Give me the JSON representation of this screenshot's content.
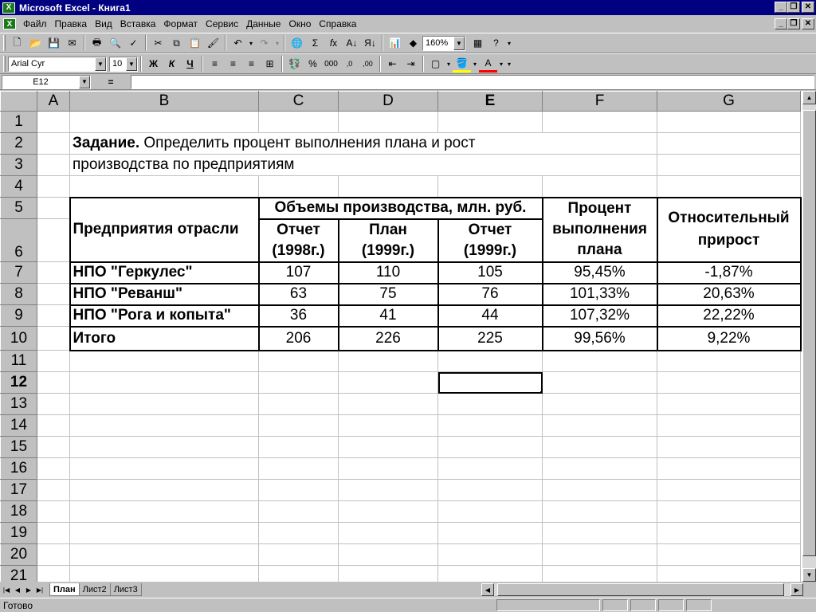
{
  "window": {
    "title": "Microsoft Excel - Книга1"
  },
  "menu": [
    "Файл",
    "Правка",
    "Вид",
    "Вставка",
    "Формат",
    "Сервис",
    "Данные",
    "Окно",
    "Справка"
  ],
  "toolbar": {
    "zoom": "160%",
    "font": "Arial Cyr",
    "size": "10",
    "bold": "Ж",
    "italic": "К",
    "underline": "Ч"
  },
  "formula": {
    "cell_ref": "E12",
    "eq": "=",
    "value": ""
  },
  "columns": [
    "A",
    "B",
    "C",
    "D",
    "E",
    "F",
    "G"
  ],
  "rows": [
    "1",
    "2",
    "3",
    "4",
    "5",
    "6",
    "7",
    "8",
    "9",
    "10",
    "11",
    "12",
    "13",
    "14",
    "15",
    "16",
    "17",
    "18",
    "19",
    "20",
    "21"
  ],
  "task": {
    "bold": "Задание.",
    "text1": "Определить процент выполнения плана и рост",
    "text2": "производства по предприятиям"
  },
  "table": {
    "h_enterprise": "Предприятия отрасли",
    "h_volumes": "Объемы производства, млн. руб.",
    "h_percent": [
      "Процент",
      "выполнения",
      "плана"
    ],
    "h_growth": [
      "Относительный",
      "прирост"
    ],
    "h_c": [
      "Отчет",
      "(1998г.)"
    ],
    "h_d": [
      "План",
      "(1999г.)"
    ],
    "h_e": [
      "Отчет",
      "(1999г.)"
    ],
    "rows": [
      {
        "name": "НПО \"Геркулес\"",
        "c": "107",
        "d": "110",
        "e": "105",
        "f": "95,45%",
        "g": "-1,87%"
      },
      {
        "name": "НПО \"Реванш\"",
        "c": "63",
        "d": "75",
        "e": "76",
        "f": "101,33%",
        "g": "20,63%"
      },
      {
        "name": "НПО \"Рога и копыта\"",
        "c": "36",
        "d": "41",
        "e": "44",
        "f": "107,32%",
        "g": "22,22%"
      }
    ],
    "total": {
      "name": "Итого",
      "c": "206",
      "d": "226",
      "e": "225",
      "f": "99,56%",
      "g": "9,22%"
    }
  },
  "sheets": [
    "План",
    "Лист2",
    "Лист3"
  ],
  "status": "Готово"
}
